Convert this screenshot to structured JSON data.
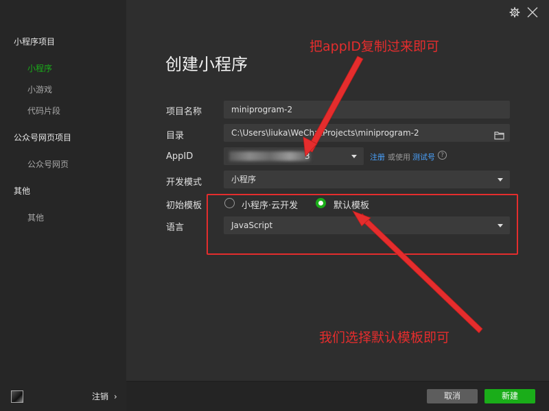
{
  "sidebar": {
    "groups": [
      {
        "label": "小程序项目",
        "items": [
          "小程序",
          "小游戏",
          "代码片段"
        ]
      },
      {
        "label": "公众号网页项目",
        "items": [
          "公众号网页"
        ]
      },
      {
        "label": "其他",
        "items": [
          "其他"
        ]
      }
    ],
    "active_item": "小程序",
    "logout_label": "注销",
    "logout_chevron": "›"
  },
  "window": {
    "settings_icon": "gear-icon",
    "close_icon": "close-icon"
  },
  "form": {
    "title": "创建小程序",
    "project_name": {
      "label": "项目名称",
      "value": "miniprogram-2"
    },
    "directory": {
      "label": "目录",
      "value": "C:\\Users\\liuka\\WeChatProjects\\miniprogram-2",
      "icon": "folder-icon"
    },
    "appid": {
      "label": "AppID",
      "value_tail": "3",
      "register_link": "注册",
      "or_use": "或使用",
      "test_link": "测试号",
      "help_glyph": "?"
    },
    "dev_mode": {
      "label": "开发模式",
      "value": "小程序"
    },
    "template": {
      "label": "初始模板",
      "options": [
        "小程序·云开发",
        "默认模板"
      ],
      "selected": 1
    },
    "language": {
      "label": "语言",
      "value": "JavaScript"
    }
  },
  "annotations": {
    "top_text": "把appID复制过来即可",
    "bottom_text": "我们选择默认模板即可",
    "color": "#e52d2d"
  },
  "footer": {
    "cancel_label": "取消",
    "create_label": "新建"
  },
  "colors": {
    "accent": "#1aad19",
    "link": "#4aa3ff",
    "background": "#2e2e2e",
    "sidebar": "#262626"
  }
}
